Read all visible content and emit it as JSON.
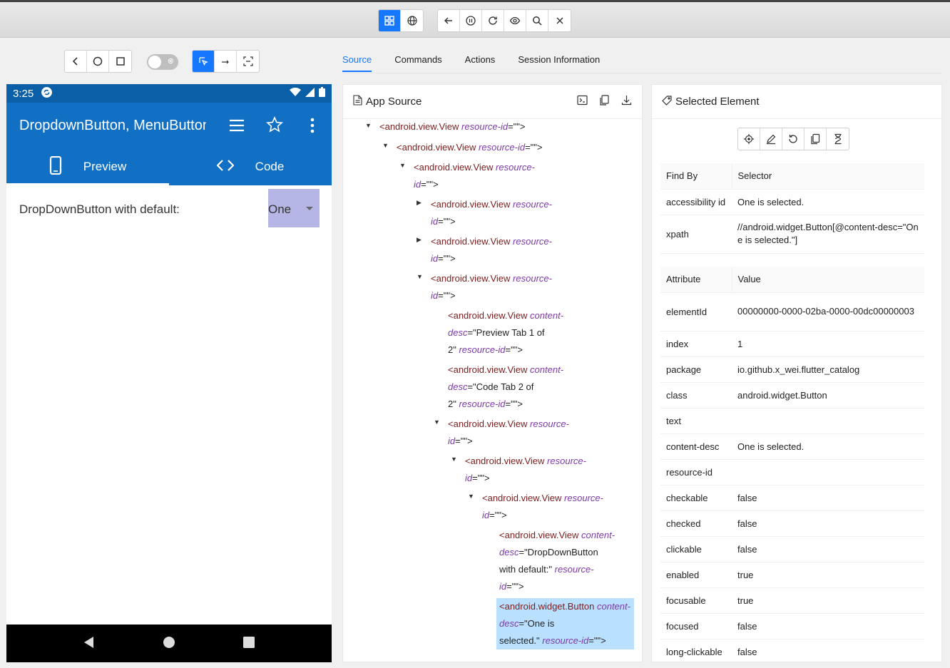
{
  "toolbar": {
    "icons": [
      "grid-icon",
      "globe-icon",
      "back-arrow-icon",
      "pause-icon",
      "refresh-icon",
      "eye-icon",
      "search-icon",
      "close-icon"
    ]
  },
  "device_controls": {
    "icons": [
      "back-icon",
      "home-circle-icon",
      "recents-square-icon"
    ],
    "mode_icons": [
      "select-mode-icon",
      "swipe-mode-icon",
      "tap-coords-icon"
    ]
  },
  "tabs": [
    "Source",
    "Commands",
    "Actions",
    "Session Information"
  ],
  "phone": {
    "time": "3:25",
    "app_title": "DropdownButton, MenuButton",
    "tab_preview": "Preview",
    "tab_code": "Code",
    "dropdown_label": "DropDownButton with default:",
    "dropdown_value": "One"
  },
  "source": {
    "title": "App Source",
    "nodes": [
      {
        "tag": "<android.view.View",
        "attrs": [
          {
            "k": "resource-id",
            "v": "\"\">"
          }
        ],
        "lines": [
          "resource-id=\"\">"
        ]
      }
    ]
  },
  "selected": {
    "title": "Selected Element",
    "find_header": [
      "Find By",
      "Selector"
    ],
    "find_rows": [
      [
        "accessibility id",
        "One is selected."
      ],
      [
        "xpath",
        "//android.widget.Button[@content-desc=\"One is selected.\"]"
      ]
    ],
    "attr_header": [
      "Attribute",
      "Value"
    ],
    "attr_rows": [
      [
        "elementId",
        "00000000-0000-02ba-0000-00dc00000003"
      ],
      [
        "index",
        "1"
      ],
      [
        "package",
        "io.github.x_wei.flutter_catalog"
      ],
      [
        "class",
        "android.widget.Button"
      ],
      [
        "text",
        ""
      ],
      [
        "content-desc",
        "One is selected."
      ],
      [
        "resource-id",
        ""
      ],
      [
        "checkable",
        "false"
      ],
      [
        "checked",
        "false"
      ],
      [
        "clickable",
        "false"
      ],
      [
        "enabled",
        "true"
      ],
      [
        "focusable",
        "true"
      ],
      [
        "focused",
        "false"
      ],
      [
        "long-clickable",
        "false"
      ]
    ]
  }
}
